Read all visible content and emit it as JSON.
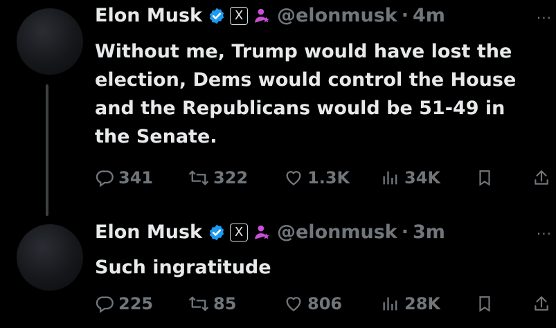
{
  "tweets": [
    {
      "author_name": "Elon Musk",
      "handle": "@elonmusk",
      "separator": "·",
      "time": "4m",
      "text": "Without me, Trump would have lost the election, Dems would control the House and the Republicans would be 51-49 in the Senate.",
      "replies": "341",
      "retweets": "322",
      "likes": "1.3K",
      "views": "34K"
    },
    {
      "author_name": "Elon Musk",
      "handle": "@elonmusk",
      "separator": "·",
      "time": "3m",
      "text": "Such ingratitude",
      "replies": "225",
      "retweets": "85",
      "likes": "806",
      "views": "28K"
    }
  ],
  "x_badge_label": "X",
  "more_label": "···",
  "colors": {
    "verified": "#1d9bf0",
    "affiliate": "#c94fd8",
    "muted": "#71767b",
    "text": "#e7e9ea"
  }
}
